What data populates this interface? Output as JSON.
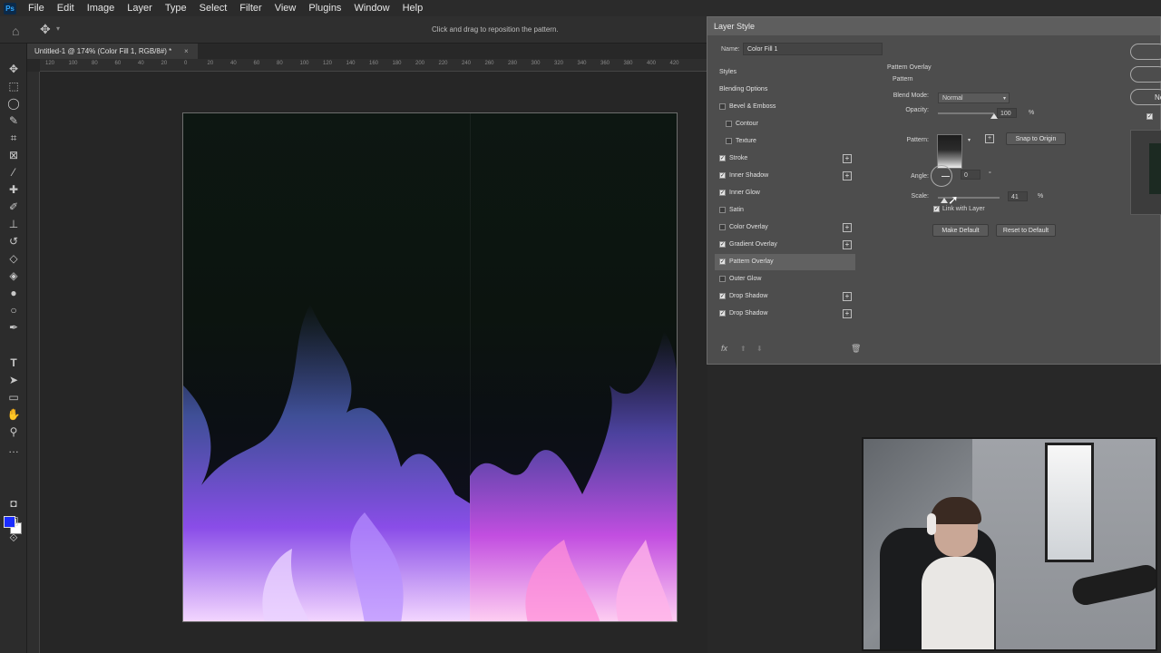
{
  "app": {
    "logo": "Ps"
  },
  "menu": [
    "File",
    "Edit",
    "Image",
    "Layer",
    "Type",
    "Select",
    "Filter",
    "View",
    "Plugins",
    "Window",
    "Help"
  ],
  "options_bar": {
    "hint": "Click and drag to reposition the pattern."
  },
  "document": {
    "tab_title": "Untitled-1 @ 174% (Color Fill 1, RGB/8#) *",
    "close_glyph": "×",
    "ruler_ticks": [
      "120",
      "100",
      "80",
      "60",
      "40",
      "20",
      "0",
      "20",
      "40",
      "60",
      "80",
      "100",
      "120",
      "140",
      "160",
      "180",
      "200",
      "220",
      "240",
      "260",
      "280",
      "300",
      "320",
      "340",
      "360",
      "380",
      "400",
      "420"
    ]
  },
  "layer_style": {
    "title": "Layer Style",
    "name_label": "Name:",
    "name_value": "Color Fill 1",
    "styles": [
      {
        "label": "Styles",
        "kind": "header"
      },
      {
        "label": "Blending Options",
        "kind": "header"
      },
      {
        "label": "Bevel & Emboss",
        "checked": false,
        "plus": false
      },
      {
        "label": "Contour",
        "checked": false,
        "plus": false,
        "indent": true
      },
      {
        "label": "Texture",
        "checked": false,
        "plus": false,
        "indent": true
      },
      {
        "label": "Stroke",
        "checked": true,
        "plus": true
      },
      {
        "label": "Inner Shadow",
        "checked": true,
        "plus": true
      },
      {
        "label": "Inner Glow",
        "checked": true,
        "plus": false
      },
      {
        "label": "Satin",
        "checked": false,
        "plus": false
      },
      {
        "label": "Color Overlay",
        "checked": false,
        "plus": true
      },
      {
        "label": "Gradient Overlay",
        "checked": true,
        "plus": true
      },
      {
        "label": "Pattern Overlay",
        "checked": true,
        "plus": false,
        "selected": true
      },
      {
        "label": "Outer Glow",
        "checked": false,
        "plus": false
      },
      {
        "label": "Drop Shadow",
        "checked": true,
        "plus": true
      },
      {
        "label": "Drop Shadow",
        "checked": true,
        "plus": true
      }
    ],
    "footer": {
      "fx": "fx",
      "up": "⬆",
      "down": "⬇",
      "trash": "🗑"
    },
    "panel": {
      "title": "Pattern Overlay",
      "group": "Pattern",
      "blend_mode_label": "Blend Mode:",
      "blend_mode_value": "Normal",
      "opacity_label": "Opacity:",
      "opacity_value": "100",
      "opacity_unit": "%",
      "opacity_fraction": 1.0,
      "pattern_label": "Pattern:",
      "snap_button": "Snap to Origin",
      "angle_label": "Angle:",
      "angle_value": "0",
      "angle_unit": "°",
      "scale_label": "Scale:",
      "scale_value": "41",
      "scale_unit": "%",
      "link_label": "Link with Layer",
      "link_checked": true,
      "make_default": "Make Default",
      "reset_default": "Reset to Default"
    },
    "right_buttons": [
      "",
      "",
      "Ne"
    ]
  }
}
